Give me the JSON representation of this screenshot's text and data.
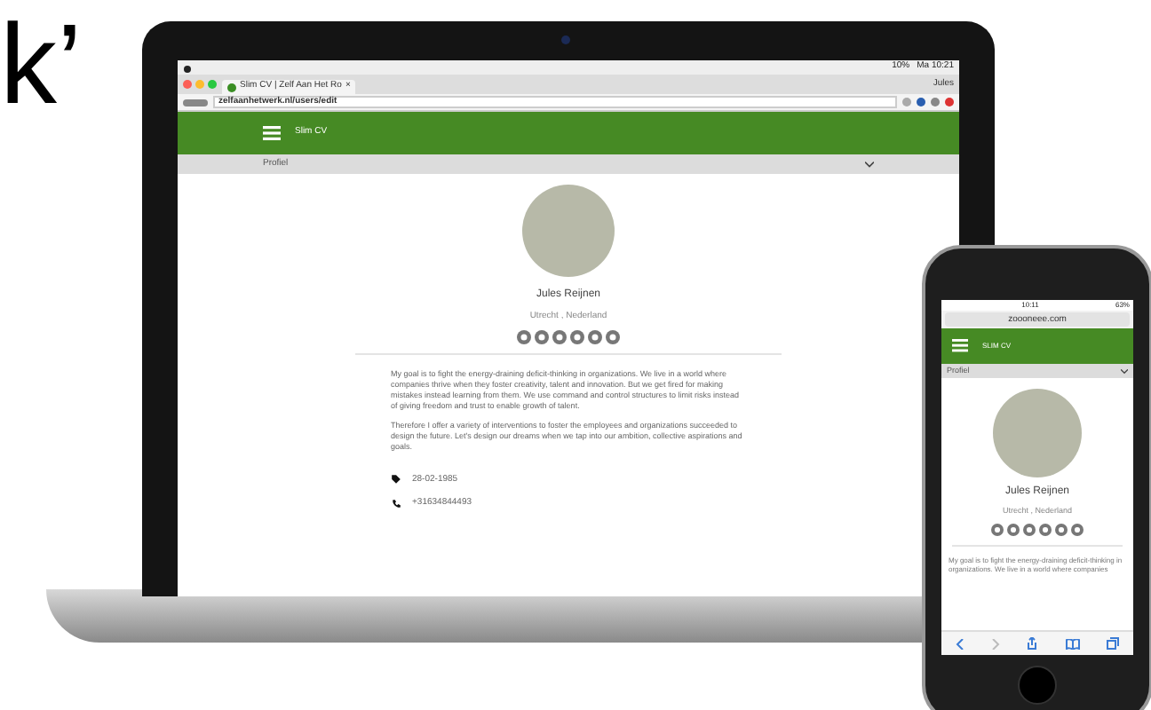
{
  "headline": "k’",
  "laptop": {
    "menu_bar": {
      "status": [
        "10%",
        "Ma 10:21"
      ]
    },
    "browser": {
      "tab": "Slim CV | Zelf Aan Het Ro",
      "tab_close": "×",
      "user": "Jules",
      "url": "zelfaanhetwerk.nl/users/edit"
    },
    "page": {
      "app_title": "Slim CV",
      "section": "Profiel",
      "name": "Jules Reijnen",
      "location": "Utrecht , Nederland",
      "paragraphs": [
        "My goal is to fight the energy-draining deficit-thinking in organizations. We live in a world where companies thrive when they foster creativity, talent and innovation. But we get fired for making mistakes instead learning from them. We use command and control structures to limit risks instead of giving freedom and trust to enable growth of talent.",
        "Therefore I offer a variety of interventions to foster the employees and organizations succeeded to design the future. Let's design our dreams when we tap into our ambition, collective aspirations and goals."
      ],
      "details": [
        {
          "kind": "birthday",
          "text": "28-02-1985"
        },
        {
          "kind": "phone",
          "text": "+31634844493"
        }
      ]
    }
  },
  "phone": {
    "status": {
      "time": "10:11",
      "battery": "63%"
    },
    "url": "zoooneee.com",
    "page": {
      "app_title": "SLIM CV",
      "section": "Profiel",
      "name": "Jules Reijnen",
      "location": "Utrecht , Nederland",
      "paragraphs": [
        "My goal is to fight the energy-draining deficit-thinking in organizations. We live in a world where companies"
      ]
    }
  }
}
